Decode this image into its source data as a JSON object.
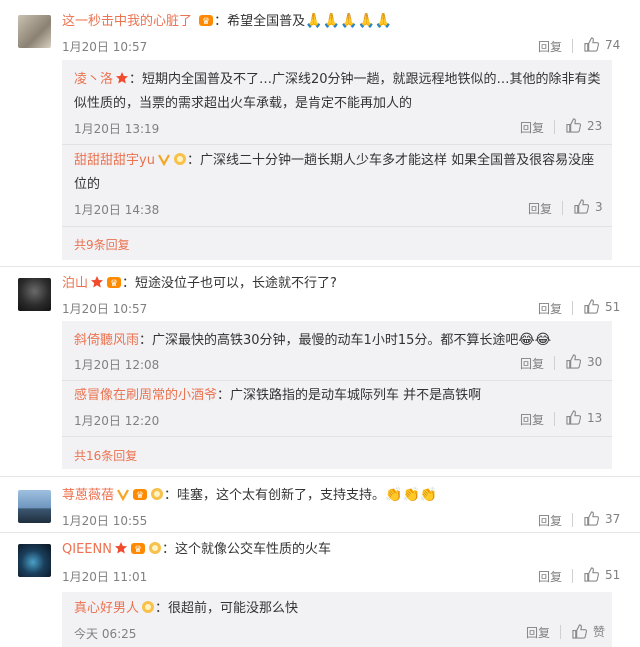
{
  "comments": [
    {
      "user": "这一秒击中我的心脏了",
      "text": "：希望全国普及",
      "emoji": "🙏🙏🙏🙏🙏",
      "time": "1月20日 10:57",
      "reply": "回复",
      "likes": "74",
      "replies": [
        {
          "user": "凌丶洛",
          "text": "：短期内全国普及不了…广深线20分钟一趟，就跟远程地铁似的…其他的除非有类似性质的，当票的需求超出火车承载，是肯定不能再加人的",
          "time": "1月20日 13:19",
          "reply": "回复",
          "likes": "23"
        },
        {
          "user": "甜甜甜甜宇yu",
          "text": "：广深线二十分钟一趟长期人少车多才能这样 如果全国普及很容易没座位的",
          "time": "1月20日 14:38",
          "reply": "回复",
          "likes": "3"
        }
      ],
      "more": "共9条回复"
    },
    {
      "user": "泊山",
      "text": "：短途没位子也可以，长途就不行了?",
      "time": "1月20日 10:57",
      "reply": "回复",
      "likes": "51",
      "replies": [
        {
          "user": "斜倚聽风雨",
          "text": "：广深最快的高铁30分钟，最慢的动车1小时15分。都不算长途吧",
          "emoji": "😂😂",
          "time": "1月20日 12:08",
          "reply": "回复",
          "likes": "30"
        },
        {
          "user": "感冒像在刷周常的小酒爷",
          "text": "：广深铁路指的是动车城际列车 并不是高铁啊",
          "time": "1月20日 12:20",
          "reply": "回复",
          "likes": "13"
        }
      ],
      "more": "共16条回复"
    },
    {
      "user": "荨蒽薇蓓",
      "text": "：哇塞，这个太有创新了，支持支持。",
      "emoji": "👏👏👏",
      "time": "1月20日 10:55",
      "reply": "回复",
      "likes": "37"
    },
    {
      "user": "QIEENN",
      "text": "：这个就像公交车性质的火车",
      "time": "1月20日 11:01",
      "reply": "回复",
      "likes": "51",
      "replies": [
        {
          "user": "真心好男人",
          "text": "：很超前，可能没那么快",
          "time": "今天 06:25",
          "reply": "回复",
          "likes": "赞"
        }
      ]
    }
  ],
  "colors": {
    "username": "#eb7350",
    "reply_bg": "#f2f2f5",
    "meta": "#808080"
  }
}
